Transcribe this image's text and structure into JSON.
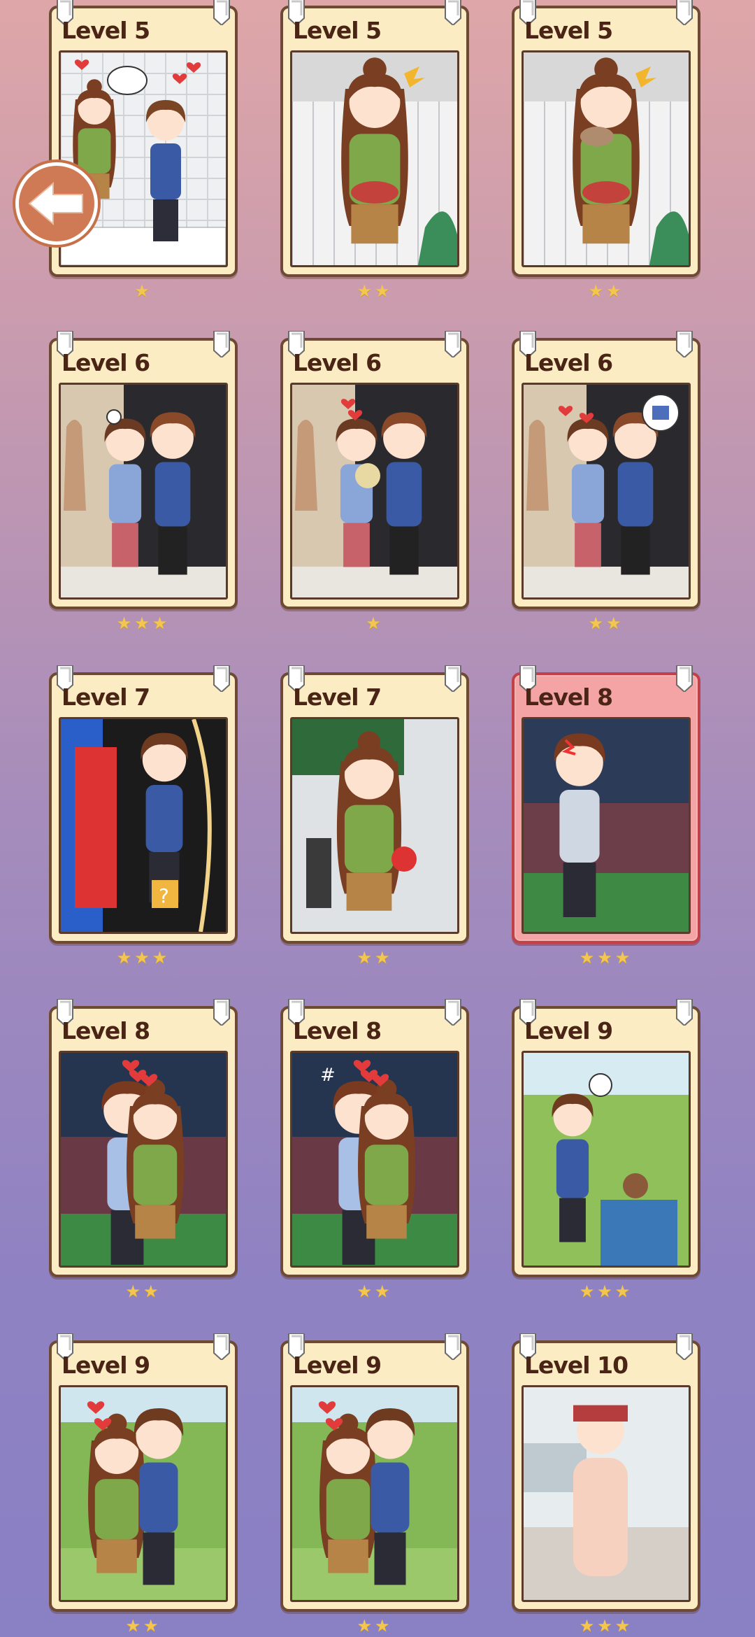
{
  "back_button": {
    "icon": "arrow-left-icon"
  },
  "cards": [
    {
      "level": "Level 5",
      "stars": 1,
      "scene": "kitchen-couple",
      "active": false
    },
    {
      "level": "Level 5",
      "stars": 2,
      "scene": "girl-bowl",
      "active": false
    },
    {
      "level": "Level 5",
      "stars": 2,
      "scene": "girl-eating",
      "active": false
    },
    {
      "level": "Level 6",
      "stars": 3,
      "scene": "doorway-slap",
      "active": false
    },
    {
      "level": "Level 6",
      "stars": 1,
      "scene": "doorway-flowers",
      "active": false
    },
    {
      "level": "Level 6",
      "stars": 2,
      "scene": "doorway-shirt",
      "active": false
    },
    {
      "level": "Level 7",
      "stars": 3,
      "scene": "arcade-boy",
      "active": false
    },
    {
      "level": "Level 7",
      "stars": 2,
      "scene": "arcade-girl",
      "active": false
    },
    {
      "level": "Level 8",
      "stars": 3,
      "scene": "stadium-angry",
      "active": true
    },
    {
      "level": "Level 8",
      "stars": 2,
      "scene": "stadium-hug",
      "active": false
    },
    {
      "level": "Level 8",
      "stars": 2,
      "scene": "stadium-hug-2",
      "active": false
    },
    {
      "level": "Level 9",
      "stars": 3,
      "scene": "garden-bear",
      "active": false
    },
    {
      "level": "Level 9",
      "stars": 2,
      "scene": "garden-kiss",
      "active": false
    },
    {
      "level": "Level 9",
      "stars": 2,
      "scene": "garden-embrace",
      "active": false
    },
    {
      "level": "Level 10",
      "stars": 3,
      "scene": "bathroom-shirtless",
      "active": false
    }
  ],
  "colors": {
    "star": "#f2c64f",
    "card": "#fbecc4",
    "card_active": "#f4a4a4",
    "border": "#6e4a35"
  }
}
